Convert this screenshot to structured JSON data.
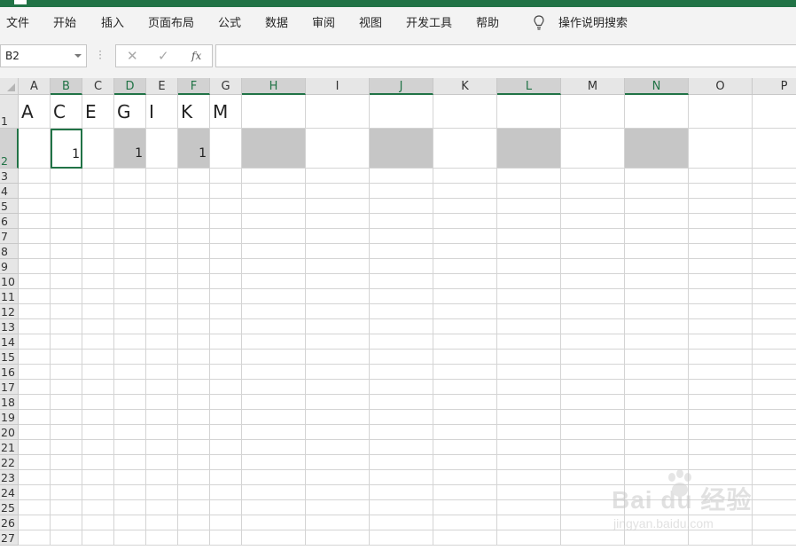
{
  "menubar": {
    "items": [
      {
        "label": "文件"
      },
      {
        "label": "开始"
      },
      {
        "label": "插入"
      },
      {
        "label": "页面布局"
      },
      {
        "label": "公式"
      },
      {
        "label": "数据"
      },
      {
        "label": "审阅"
      },
      {
        "label": "视图"
      },
      {
        "label": "开发工具"
      },
      {
        "label": "帮助"
      }
    ],
    "tell_me": "操作说明搜索"
  },
  "formula_bar": {
    "name_box": "B2",
    "cancel_icon": "✕",
    "enter_icon": "✓",
    "fx_icon": "fx",
    "formula": ""
  },
  "sheet": {
    "columns": [
      "A",
      "B",
      "C",
      "D",
      "E",
      "F",
      "G",
      "H",
      "I",
      "J",
      "K",
      "L",
      "M",
      "N",
      "O",
      "P"
    ],
    "selected_columns": [
      "B",
      "D",
      "F",
      "H",
      "J",
      "L",
      "N"
    ],
    "rows": [
      "1",
      "2",
      "3",
      "4",
      "5",
      "6",
      "7",
      "8",
      "9",
      "10",
      "11",
      "12",
      "13",
      "14",
      "15",
      "16",
      "17",
      "18",
      "19",
      "20",
      "21",
      "22",
      "23",
      "24",
      "25",
      "26",
      "27"
    ],
    "selected_rows": [
      "2"
    ],
    "active_cell": "B2",
    "row1_values": [
      "A",
      "C",
      "E",
      "G",
      "I",
      "K",
      "M"
    ],
    "row2_values": {
      "B2": "1",
      "D2": "1",
      "F2": "1"
    },
    "selection_fill": "#c6c6c6",
    "accent": "#217346"
  },
  "watermark": {
    "brand": "Bai du 经验",
    "url": "jingyan.baidu.com"
  }
}
